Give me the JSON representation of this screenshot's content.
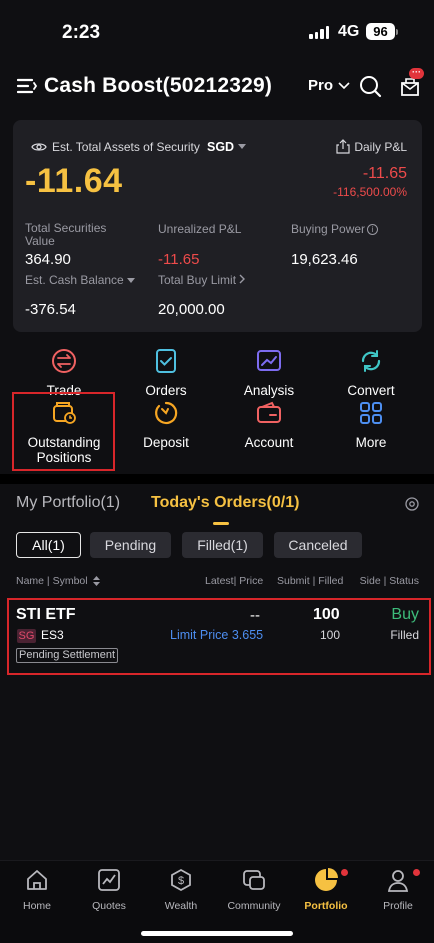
{
  "status_bar": {
    "time": "2:23",
    "network": "4G",
    "battery": "96"
  },
  "header": {
    "title": "Cash Boost(50212329)",
    "mode": "Pro",
    "badge": "···"
  },
  "assets": {
    "est_label": "Est. Total Assets of Security",
    "currency": "SGD",
    "total_value": "-11.64",
    "daily_label": "Daily P&L",
    "daily_value": "-11.65",
    "daily_pct": "-116,500.00%",
    "metrics": [
      {
        "label": "Total Securities Value",
        "value": "364.90"
      },
      {
        "label": "Unrealized P&L",
        "value": "-11.65"
      },
      {
        "label": "Buying Power",
        "value": "19,623.46"
      },
      {
        "label": "Est. Cash Balance",
        "value": "-376.54"
      },
      {
        "label": "Total Buy Limit",
        "value": "20,000.00"
      }
    ]
  },
  "actions": [
    {
      "label": "Trade",
      "icon": "trade-icon"
    },
    {
      "label": "Orders",
      "icon": "orders-icon"
    },
    {
      "label": "Analysis",
      "icon": "analysis-icon"
    },
    {
      "label": "Convert",
      "icon": "convert-icon"
    },
    {
      "label": "Outstanding Positions",
      "icon": "outstanding-positions-icon"
    },
    {
      "label": "Deposit",
      "icon": "deposit-icon"
    },
    {
      "label": "Account",
      "icon": "account-icon"
    },
    {
      "label": "More",
      "icon": "more-grid-icon"
    }
  ],
  "portfolio_tabs": [
    {
      "label": "My Portfolio(1)",
      "active": false
    },
    {
      "label": "Today's Orders(0/1)",
      "active": true
    }
  ],
  "filters": [
    "All(1)",
    "Pending",
    "Filled(1)",
    "Canceled"
  ],
  "columns": {
    "name": "Name | Symbol",
    "price": "Latest| Price",
    "submit": "Submit | Filled",
    "side": "Side | Status"
  },
  "order": {
    "name": "STI ETF",
    "market": "SG",
    "symbol": "ES3",
    "latest_price": "--",
    "limit": "Limit Price 3.655",
    "submitted": "100",
    "filled": "100",
    "side": "Buy",
    "status": "Filled",
    "settlement": "Pending Settlement"
  },
  "colors": {
    "accent": "#f6c142",
    "negative": "#ee4b4b",
    "buy": "#3dbb7a",
    "link": "#4d8ef0",
    "highlight": "#d8262a"
  },
  "nav": [
    {
      "label": "Home",
      "icon": "home-icon"
    },
    {
      "label": "Quotes",
      "icon": "quotes-icon"
    },
    {
      "label": "Wealth",
      "icon": "wealth-icon"
    },
    {
      "label": "Community",
      "icon": "community-icon"
    },
    {
      "label": "Portfolio",
      "icon": "portfolio-icon",
      "active": true
    },
    {
      "label": "Profile",
      "icon": "profile-icon"
    }
  ]
}
